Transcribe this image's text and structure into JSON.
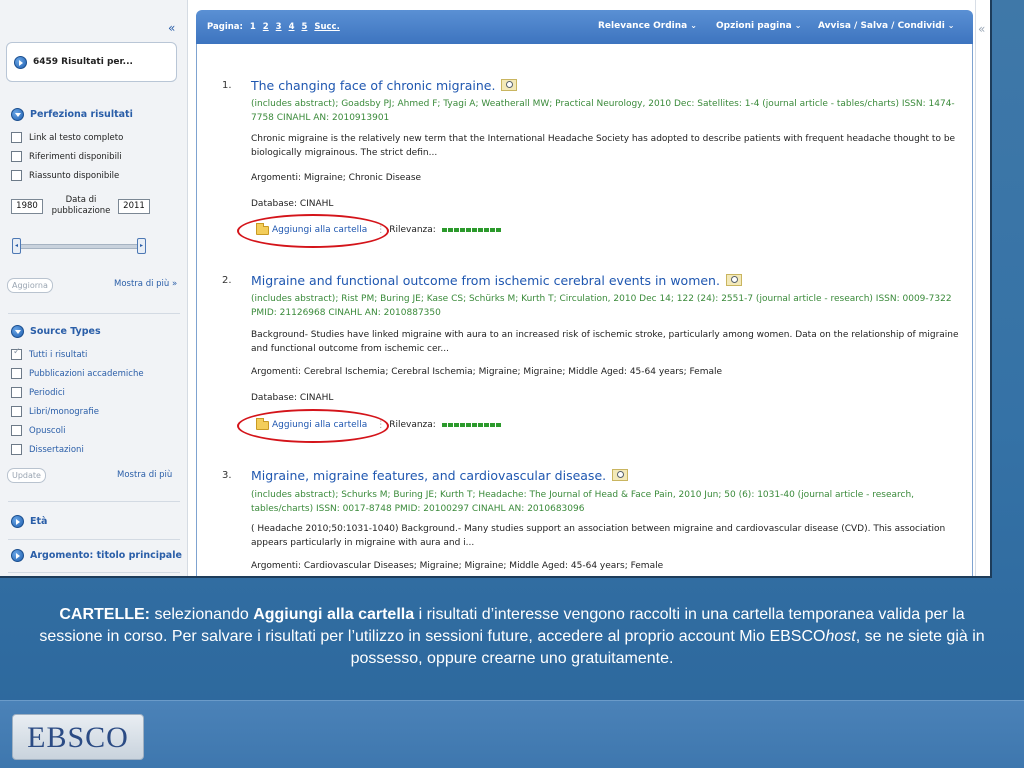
{
  "sidebar": {
    "collapse_glyph": "«",
    "results_label": "6459 Risultati per...",
    "refine_title": "Perfeziona risultati",
    "refine_options": [
      {
        "label": "Link al testo completo",
        "checked": false
      },
      {
        "label": "Riferimenti disponibili",
        "checked": false
      },
      {
        "label": "Riassunto disponibile",
        "checked": false
      }
    ],
    "date": {
      "from": "1980",
      "to": "2011",
      "label_line1": "Data di",
      "label_line2": "pubblicazione"
    },
    "update_label": "Aggiorna",
    "more_label": "Mostra di più »",
    "source_types_title": "Source Types",
    "source_types": [
      {
        "label": "Tutti i risultati",
        "checked": true
      },
      {
        "label": "Pubblicazioni accademiche",
        "checked": false
      },
      {
        "label": "Periodici",
        "checked": false
      },
      {
        "label": "Libri/monografie",
        "checked": false
      },
      {
        "label": "Opuscoli",
        "checked": false
      },
      {
        "label": "Dissertazioni",
        "checked": false
      }
    ],
    "update2_label": "Update",
    "more2_label": "Mostra di più",
    "age_title": "Età",
    "subject_title": "Argomento: titolo principale"
  },
  "topbar": {
    "page_label": "Pagina:",
    "pages": [
      "1",
      "2",
      "3",
      "4",
      "5"
    ],
    "next_label": "Succ.",
    "sort_label": "Relevance Ordina",
    "options_label": "Opzioni pagina",
    "share_label": "Avvisa / Salva / Condividi",
    "chevron": "⌄",
    "collapse_glyph": "«"
  },
  "results": [
    {
      "num": "1.",
      "title": "The changing face of chronic migraine.",
      "meta": "(includes abstract); Goadsby PJ; Ahmed F; Tyagi A; Weatherall MW; Practical Neurology, 2010 Dec: Satellites: 1-4 (journal article - tables/charts) ISSN: 1474-7758 CINAHL AN: 2010913901",
      "abstract": "Chronic migraine is the relatively new term that the International Headache Society has adopted to describe patients with frequent headache thought to be biologically migrainous. The strict defin...",
      "subjects": "Argomenti: Migraine; Chronic Disease",
      "database": "Database: CINAHL",
      "add_label": "Aggiungi alla cartella",
      "relevance_label": "Rilevanza:"
    },
    {
      "num": "2.",
      "title": "Migraine and functional outcome from ischemic cerebral events in women.",
      "meta": "(includes abstract); Rist PM; Buring JE; Kase CS; Schürks M; Kurth T; Circulation, 2010 Dec 14; 122 (24): 2551-7 (journal article - research) ISSN: 0009-7322 PMID: 21126968 CINAHL AN: 2010887350",
      "abstract": "Background- Studies have linked migraine with aura to an increased risk of ischemic stroke, particularly among women. Data on the relationship of migraine and functional outcome from ischemic cer...",
      "subjects": "Argomenti: Cerebral Ischemia; Cerebral Ischemia; Migraine; Migraine; Middle Aged: 45-64 years; Female",
      "database": "Database: CINAHL",
      "add_label": "Aggiungi alla cartella",
      "relevance_label": "Rilevanza:"
    },
    {
      "num": "3.",
      "title": "Migraine, migraine features, and cardiovascular disease.",
      "meta": "(includes abstract); Schurks M; Buring JE; Kurth T; Headache: The Journal of Head & Face Pain, 2010 Jun; 50 (6): 1031-40 (journal article - research, tables/charts) ISSN: 0017-8748 PMID: 20100297 CINAHL AN: 2010683096",
      "abstract": "( Headache 2010;50:1031-1040) Background.- Many studies support an association between migraine and cardiovascular disease (CVD). This association appears particularly in migraine with aura and i...",
      "subjects": "Argomenti: Cardiovascular Diseases; Migraine; Migraine; Middle Aged: 45-64 years; Female"
    }
  ],
  "caption": {
    "lead": "CARTELLE:",
    "part1": " selezionando ",
    "bold2": "Aggiungi alla cartella",
    "part2": " i risultati d’interesse vengono raccolti in una cartella temporanea valida per la sessione in corso. Per salvare i risultati per l’utilizzo in sessioni future, accedere al proprio account Mio EBSCO",
    "italic": "host",
    "part3": ", se ne siete già in possesso, oppure crearne uno gratuitamente."
  },
  "logo_text": "EBSCO",
  "colors": {
    "link": "#1f57b0",
    "meta_green": "#3a8a3a",
    "highlight_red": "#d4141a",
    "topbar_blue": "#3d74bf"
  }
}
